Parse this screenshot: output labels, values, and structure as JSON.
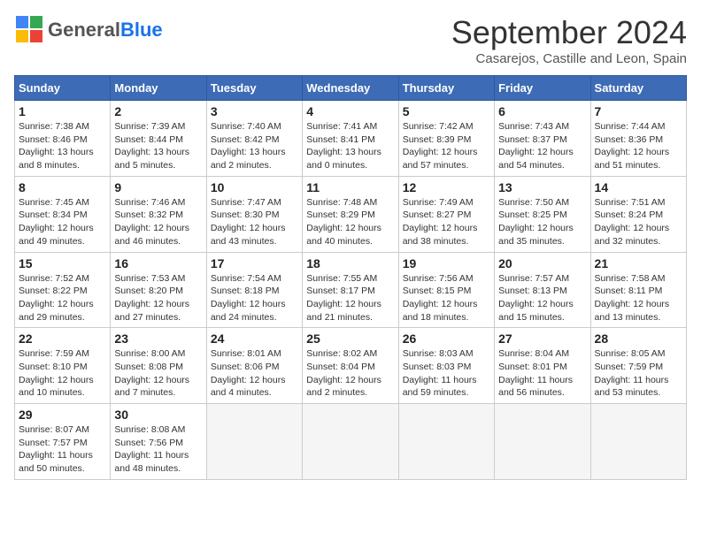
{
  "header": {
    "logo_general": "General",
    "logo_blue": "Blue",
    "main_title": "September 2024",
    "subtitle": "Casarejos, Castille and Leon, Spain"
  },
  "weekdays": [
    "Sunday",
    "Monday",
    "Tuesday",
    "Wednesday",
    "Thursday",
    "Friday",
    "Saturday"
  ],
  "weeks": [
    [
      {
        "day": "1",
        "info": "Sunrise: 7:38 AM\nSunset: 8:46 PM\nDaylight: 13 hours\nand 8 minutes.",
        "shaded": false
      },
      {
        "day": "2",
        "info": "Sunrise: 7:39 AM\nSunset: 8:44 PM\nDaylight: 13 hours\nand 5 minutes.",
        "shaded": false
      },
      {
        "day": "3",
        "info": "Sunrise: 7:40 AM\nSunset: 8:42 PM\nDaylight: 13 hours\nand 2 minutes.",
        "shaded": false
      },
      {
        "day": "4",
        "info": "Sunrise: 7:41 AM\nSunset: 8:41 PM\nDaylight: 13 hours\nand 0 minutes.",
        "shaded": false
      },
      {
        "day": "5",
        "info": "Sunrise: 7:42 AM\nSunset: 8:39 PM\nDaylight: 12 hours\nand 57 minutes.",
        "shaded": false
      },
      {
        "day": "6",
        "info": "Sunrise: 7:43 AM\nSunset: 8:37 PM\nDaylight: 12 hours\nand 54 minutes.",
        "shaded": false
      },
      {
        "day": "7",
        "info": "Sunrise: 7:44 AM\nSunset: 8:36 PM\nDaylight: 12 hours\nand 51 minutes.",
        "shaded": false
      }
    ],
    [
      {
        "day": "8",
        "info": "Sunrise: 7:45 AM\nSunset: 8:34 PM\nDaylight: 12 hours\nand 49 minutes.",
        "shaded": false
      },
      {
        "day": "9",
        "info": "Sunrise: 7:46 AM\nSunset: 8:32 PM\nDaylight: 12 hours\nand 46 minutes.",
        "shaded": false
      },
      {
        "day": "10",
        "info": "Sunrise: 7:47 AM\nSunset: 8:30 PM\nDaylight: 12 hours\nand 43 minutes.",
        "shaded": false
      },
      {
        "day": "11",
        "info": "Sunrise: 7:48 AM\nSunset: 8:29 PM\nDaylight: 12 hours\nand 40 minutes.",
        "shaded": false
      },
      {
        "day": "12",
        "info": "Sunrise: 7:49 AM\nSunset: 8:27 PM\nDaylight: 12 hours\nand 38 minutes.",
        "shaded": false
      },
      {
        "day": "13",
        "info": "Sunrise: 7:50 AM\nSunset: 8:25 PM\nDaylight: 12 hours\nand 35 minutes.",
        "shaded": false
      },
      {
        "day": "14",
        "info": "Sunrise: 7:51 AM\nSunset: 8:24 PM\nDaylight: 12 hours\nand 32 minutes.",
        "shaded": false
      }
    ],
    [
      {
        "day": "15",
        "info": "Sunrise: 7:52 AM\nSunset: 8:22 PM\nDaylight: 12 hours\nand 29 minutes.",
        "shaded": false
      },
      {
        "day": "16",
        "info": "Sunrise: 7:53 AM\nSunset: 8:20 PM\nDaylight: 12 hours\nand 27 minutes.",
        "shaded": false
      },
      {
        "day": "17",
        "info": "Sunrise: 7:54 AM\nSunset: 8:18 PM\nDaylight: 12 hours\nand 24 minutes.",
        "shaded": false
      },
      {
        "day": "18",
        "info": "Sunrise: 7:55 AM\nSunset: 8:17 PM\nDaylight: 12 hours\nand 21 minutes.",
        "shaded": false
      },
      {
        "day": "19",
        "info": "Sunrise: 7:56 AM\nSunset: 8:15 PM\nDaylight: 12 hours\nand 18 minutes.",
        "shaded": false
      },
      {
        "day": "20",
        "info": "Sunrise: 7:57 AM\nSunset: 8:13 PM\nDaylight: 12 hours\nand 15 minutes.",
        "shaded": false
      },
      {
        "day": "21",
        "info": "Sunrise: 7:58 AM\nSunset: 8:11 PM\nDaylight: 12 hours\nand 13 minutes.",
        "shaded": false
      }
    ],
    [
      {
        "day": "22",
        "info": "Sunrise: 7:59 AM\nSunset: 8:10 PM\nDaylight: 12 hours\nand 10 minutes.",
        "shaded": false
      },
      {
        "day": "23",
        "info": "Sunrise: 8:00 AM\nSunset: 8:08 PM\nDaylight: 12 hours\nand 7 minutes.",
        "shaded": false
      },
      {
        "day": "24",
        "info": "Sunrise: 8:01 AM\nSunset: 8:06 PM\nDaylight: 12 hours\nand 4 minutes.",
        "shaded": false
      },
      {
        "day": "25",
        "info": "Sunrise: 8:02 AM\nSunset: 8:04 PM\nDaylight: 12 hours\nand 2 minutes.",
        "shaded": false
      },
      {
        "day": "26",
        "info": "Sunrise: 8:03 AM\nSunset: 8:03 PM\nDaylight: 11 hours\nand 59 minutes.",
        "shaded": false
      },
      {
        "day": "27",
        "info": "Sunrise: 8:04 AM\nSunset: 8:01 PM\nDaylight: 11 hours\nand 56 minutes.",
        "shaded": false
      },
      {
        "day": "28",
        "info": "Sunrise: 8:05 AM\nSunset: 7:59 PM\nDaylight: 11 hours\nand 53 minutes.",
        "shaded": false
      }
    ],
    [
      {
        "day": "29",
        "info": "Sunrise: 8:07 AM\nSunset: 7:57 PM\nDaylight: 11 hours\nand 50 minutes.",
        "shaded": false
      },
      {
        "day": "30",
        "info": "Sunrise: 8:08 AM\nSunset: 7:56 PM\nDaylight: 11 hours\nand 48 minutes.",
        "shaded": false
      },
      {
        "day": "",
        "info": "",
        "shaded": true
      },
      {
        "day": "",
        "info": "",
        "shaded": true
      },
      {
        "day": "",
        "info": "",
        "shaded": true
      },
      {
        "day": "",
        "info": "",
        "shaded": true
      },
      {
        "day": "",
        "info": "",
        "shaded": true
      }
    ]
  ]
}
